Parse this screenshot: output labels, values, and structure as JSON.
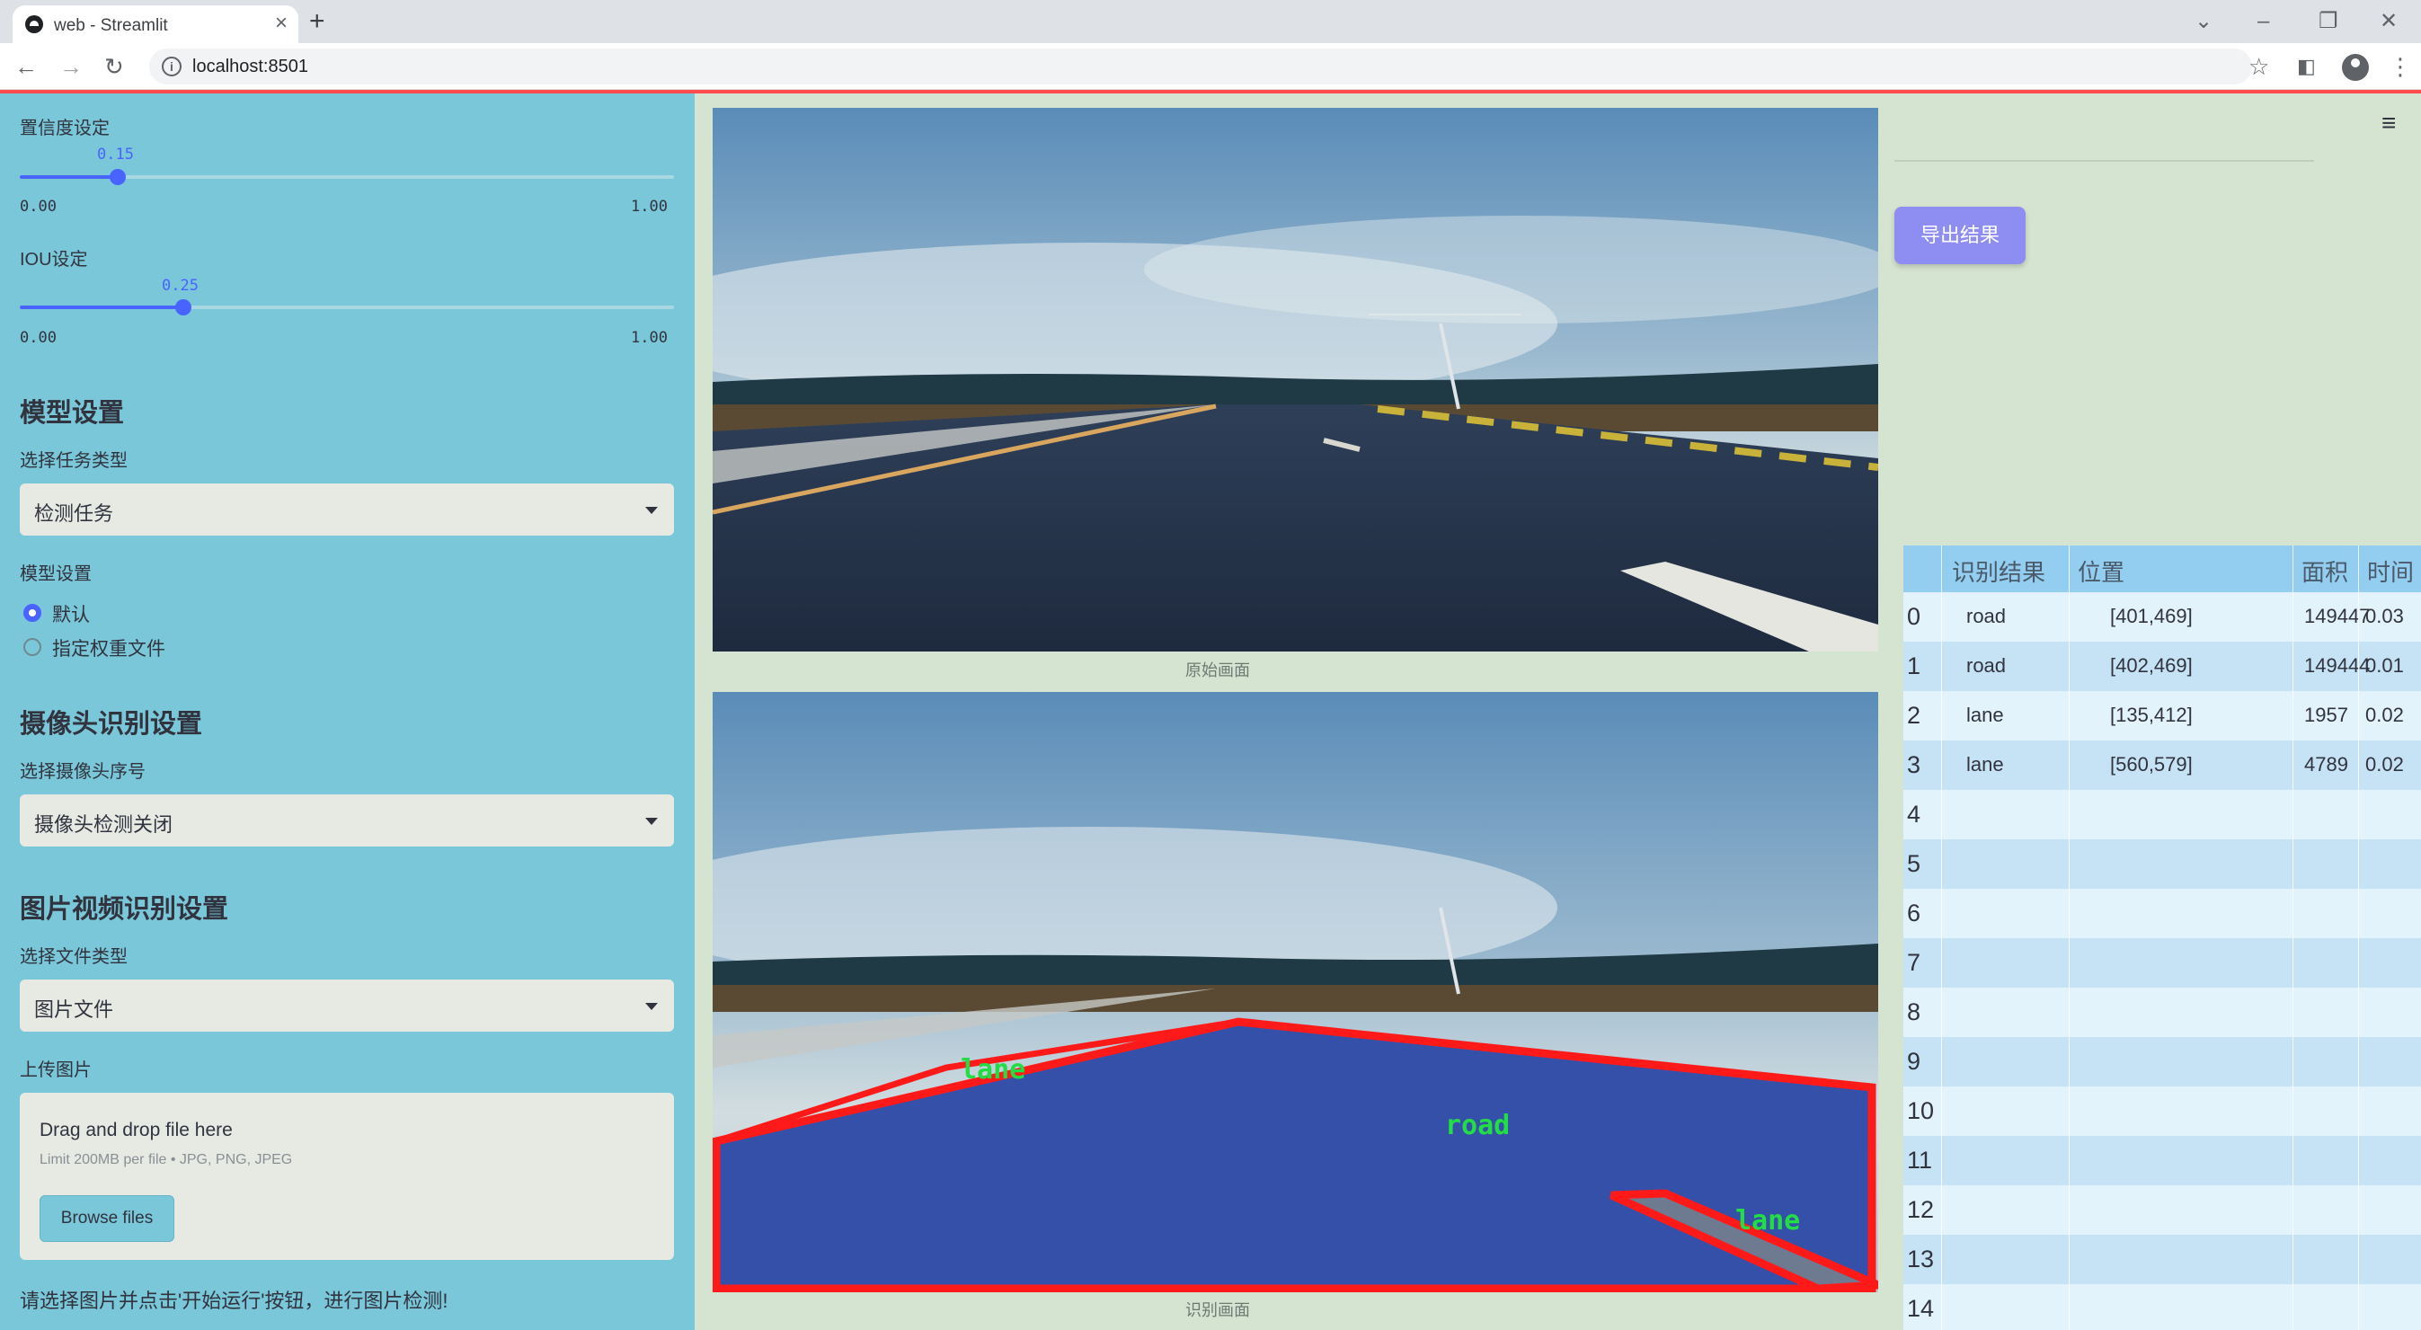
{
  "browser": {
    "tab_title": "web - Streamlit",
    "url": "localhost:8501"
  },
  "sidebar": {
    "confidence": {
      "label": "置信度设定",
      "value": "0.15",
      "min": "0.00",
      "max": "1.00",
      "level": 0.15
    },
    "iou": {
      "label": "IOU设定",
      "value": "0.25",
      "min": "0.00",
      "max": "1.00",
      "level": 0.25
    },
    "model_section": {
      "title": "模型设置",
      "task_label": "选择任务类型",
      "task_value": "检测任务",
      "model_label": "模型设置",
      "options": [
        "默认",
        "指定权重文件"
      ],
      "selected": 0
    },
    "camera_section": {
      "title": "摄像头识别设置",
      "label": "选择摄像头序号",
      "value": "摄像头检测关闭"
    },
    "media_section": {
      "title": "图片视频识别设置",
      "type_label": "选择文件类型",
      "type_value": "图片文件",
      "upload_label": "上传图片",
      "drop_title": "Drag and drop file here",
      "drop_limit": "Limit 200MB per file • JPG, PNG, JPEG",
      "browse_label": "Browse files"
    },
    "hint": "请选择图片并点击'开始运行'按钮，进行图片检测!"
  },
  "main": {
    "original_caption": "原始画面",
    "detected_caption": "识别画面",
    "export_label": "导出结果",
    "detection_labels": [
      "lane",
      "road",
      "lane"
    ]
  },
  "table": {
    "columns": [
      "识别结果",
      "位置",
      "面积",
      "时间"
    ],
    "row_indices": [
      "0",
      "1",
      "2",
      "3",
      "4",
      "5",
      "6",
      "7",
      "8",
      "9",
      "10",
      "11",
      "12",
      "13",
      "14"
    ],
    "rows": [
      [
        "road",
        "[401,469]",
        "149447",
        "0.03"
      ],
      [
        "road",
        "[402,469]",
        "149444",
        "0.01"
      ],
      [
        "lane",
        "[135,412]",
        "1957",
        "0.02"
      ],
      [
        "lane",
        "[560,579]",
        "4789",
        "0.02"
      ]
    ]
  },
  "colors": {
    "sidebar_bg": "#79c7d8",
    "accent": "#4863ff",
    "export_bg": "#8e8ef2",
    "detect_outline": "#ff1a1a",
    "detect_label": "#22dd44"
  }
}
